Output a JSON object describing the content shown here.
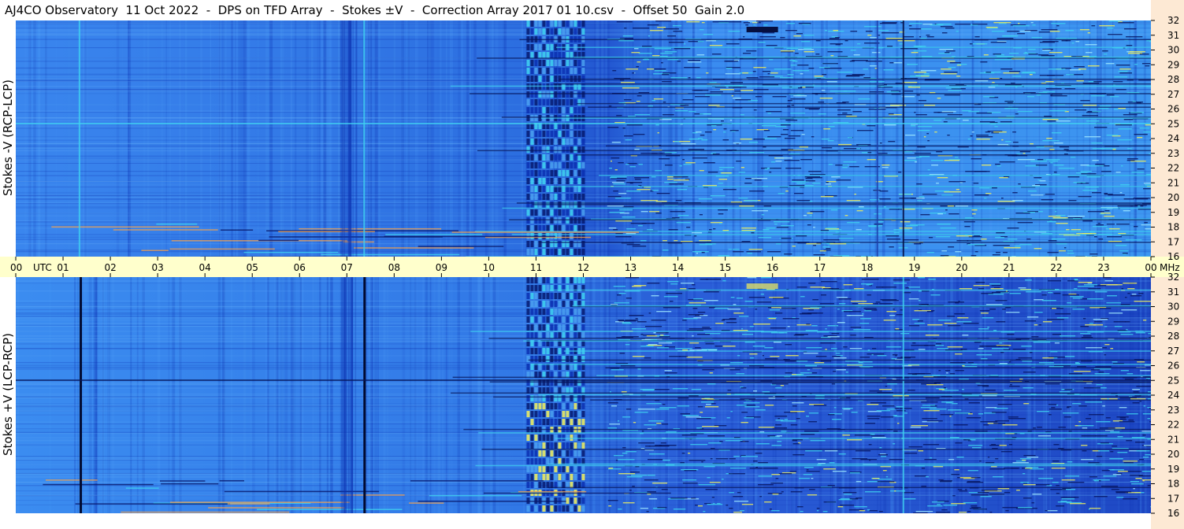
{
  "header": {
    "title": "AJ4CO Observatory  11 Oct 2022  -  DPS on TFD Array  -  Stokes ±V  -  Correction Array 2017 01 10.csv  -  Offset 50  Gain 2.0"
  },
  "chart_data": {
    "type": "heatmap",
    "panels": [
      {
        "name": "top",
        "ylabel": "Stokes -V (RCP-LCP)"
      },
      {
        "name": "bottom",
        "ylabel": "Stokes +V (LCP-RCP)"
      }
    ],
    "x_axis": {
      "unit_label": "UTC",
      "ticks": [
        "00",
        "01",
        "02",
        "03",
        "04",
        "05",
        "06",
        "07",
        "08",
        "09",
        "10",
        "11",
        "12",
        "13",
        "14",
        "15",
        "16",
        "17",
        "18",
        "19",
        "20",
        "21",
        "22",
        "23",
        "00"
      ],
      "range_hours": [
        0,
        24
      ]
    },
    "y_axis": {
      "unit_label": "MHz",
      "ticks": [
        32,
        31,
        30,
        29,
        28,
        27,
        26,
        25,
        24,
        23,
        22,
        21,
        20,
        19,
        18,
        17,
        16
      ],
      "range_mhz": [
        16,
        32
      ]
    },
    "colors": {
      "background_blue": "#2f78e8",
      "deep_blue": "#0b2fb0",
      "cyan": "#3fd2f0",
      "yellow": "#f3f05a",
      "utc_bar": "#ffffcc",
      "mhz_bar": "#fde9d4"
    }
  }
}
